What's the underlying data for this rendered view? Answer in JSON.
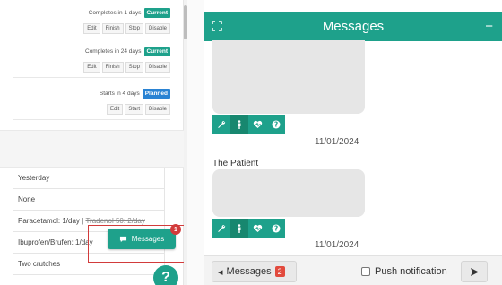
{
  "care_plan": {
    "items": [
      {
        "meta": "Completes in 1 days",
        "status": "Current",
        "actions": [
          "Edit",
          "Finish",
          "Stop",
          "Disable"
        ]
      },
      {
        "meta": "Completes in 24 days",
        "status": "Current",
        "actions": [
          "Edit",
          "Finish",
          "Stop",
          "Disable"
        ]
      },
      {
        "meta": "Starts in 4 days",
        "status": "Planned",
        "actions": [
          "Edit",
          "Start",
          "Disable"
        ]
      }
    ]
  },
  "details_table": {
    "rows": [
      {
        "text": "Yesterday"
      },
      {
        "text": "None"
      },
      {
        "text": "Paracetamol: 1/day | ",
        "struck": "Tradenol 50: 2/day"
      },
      {
        "text": "Ibuprofen/Brufen: 1/day"
      },
      {
        "text": "Two crutches"
      }
    ]
  },
  "messages_button": {
    "label": "Messages",
    "count": "1"
  },
  "help_button": {
    "label": "?"
  },
  "messages_panel": {
    "title": "Messages",
    "minimize_label": "−",
    "messages": [
      {
        "author": "",
        "date": "11/01/2024"
      },
      {
        "author": "The Patient",
        "date": "11/01/2024"
      }
    ],
    "toolbar_icons": [
      "wrench-icon",
      "figure-icon",
      "heart-pulse-icon",
      "question-icon"
    ],
    "footer": {
      "back_label": "Messages",
      "back_count": "2",
      "push_label": "Push notification",
      "send_icon": "send-icon"
    }
  },
  "colors": {
    "accent": "#1ea18b",
    "planned": "#2a83d3",
    "alert": "#d23b3b"
  }
}
